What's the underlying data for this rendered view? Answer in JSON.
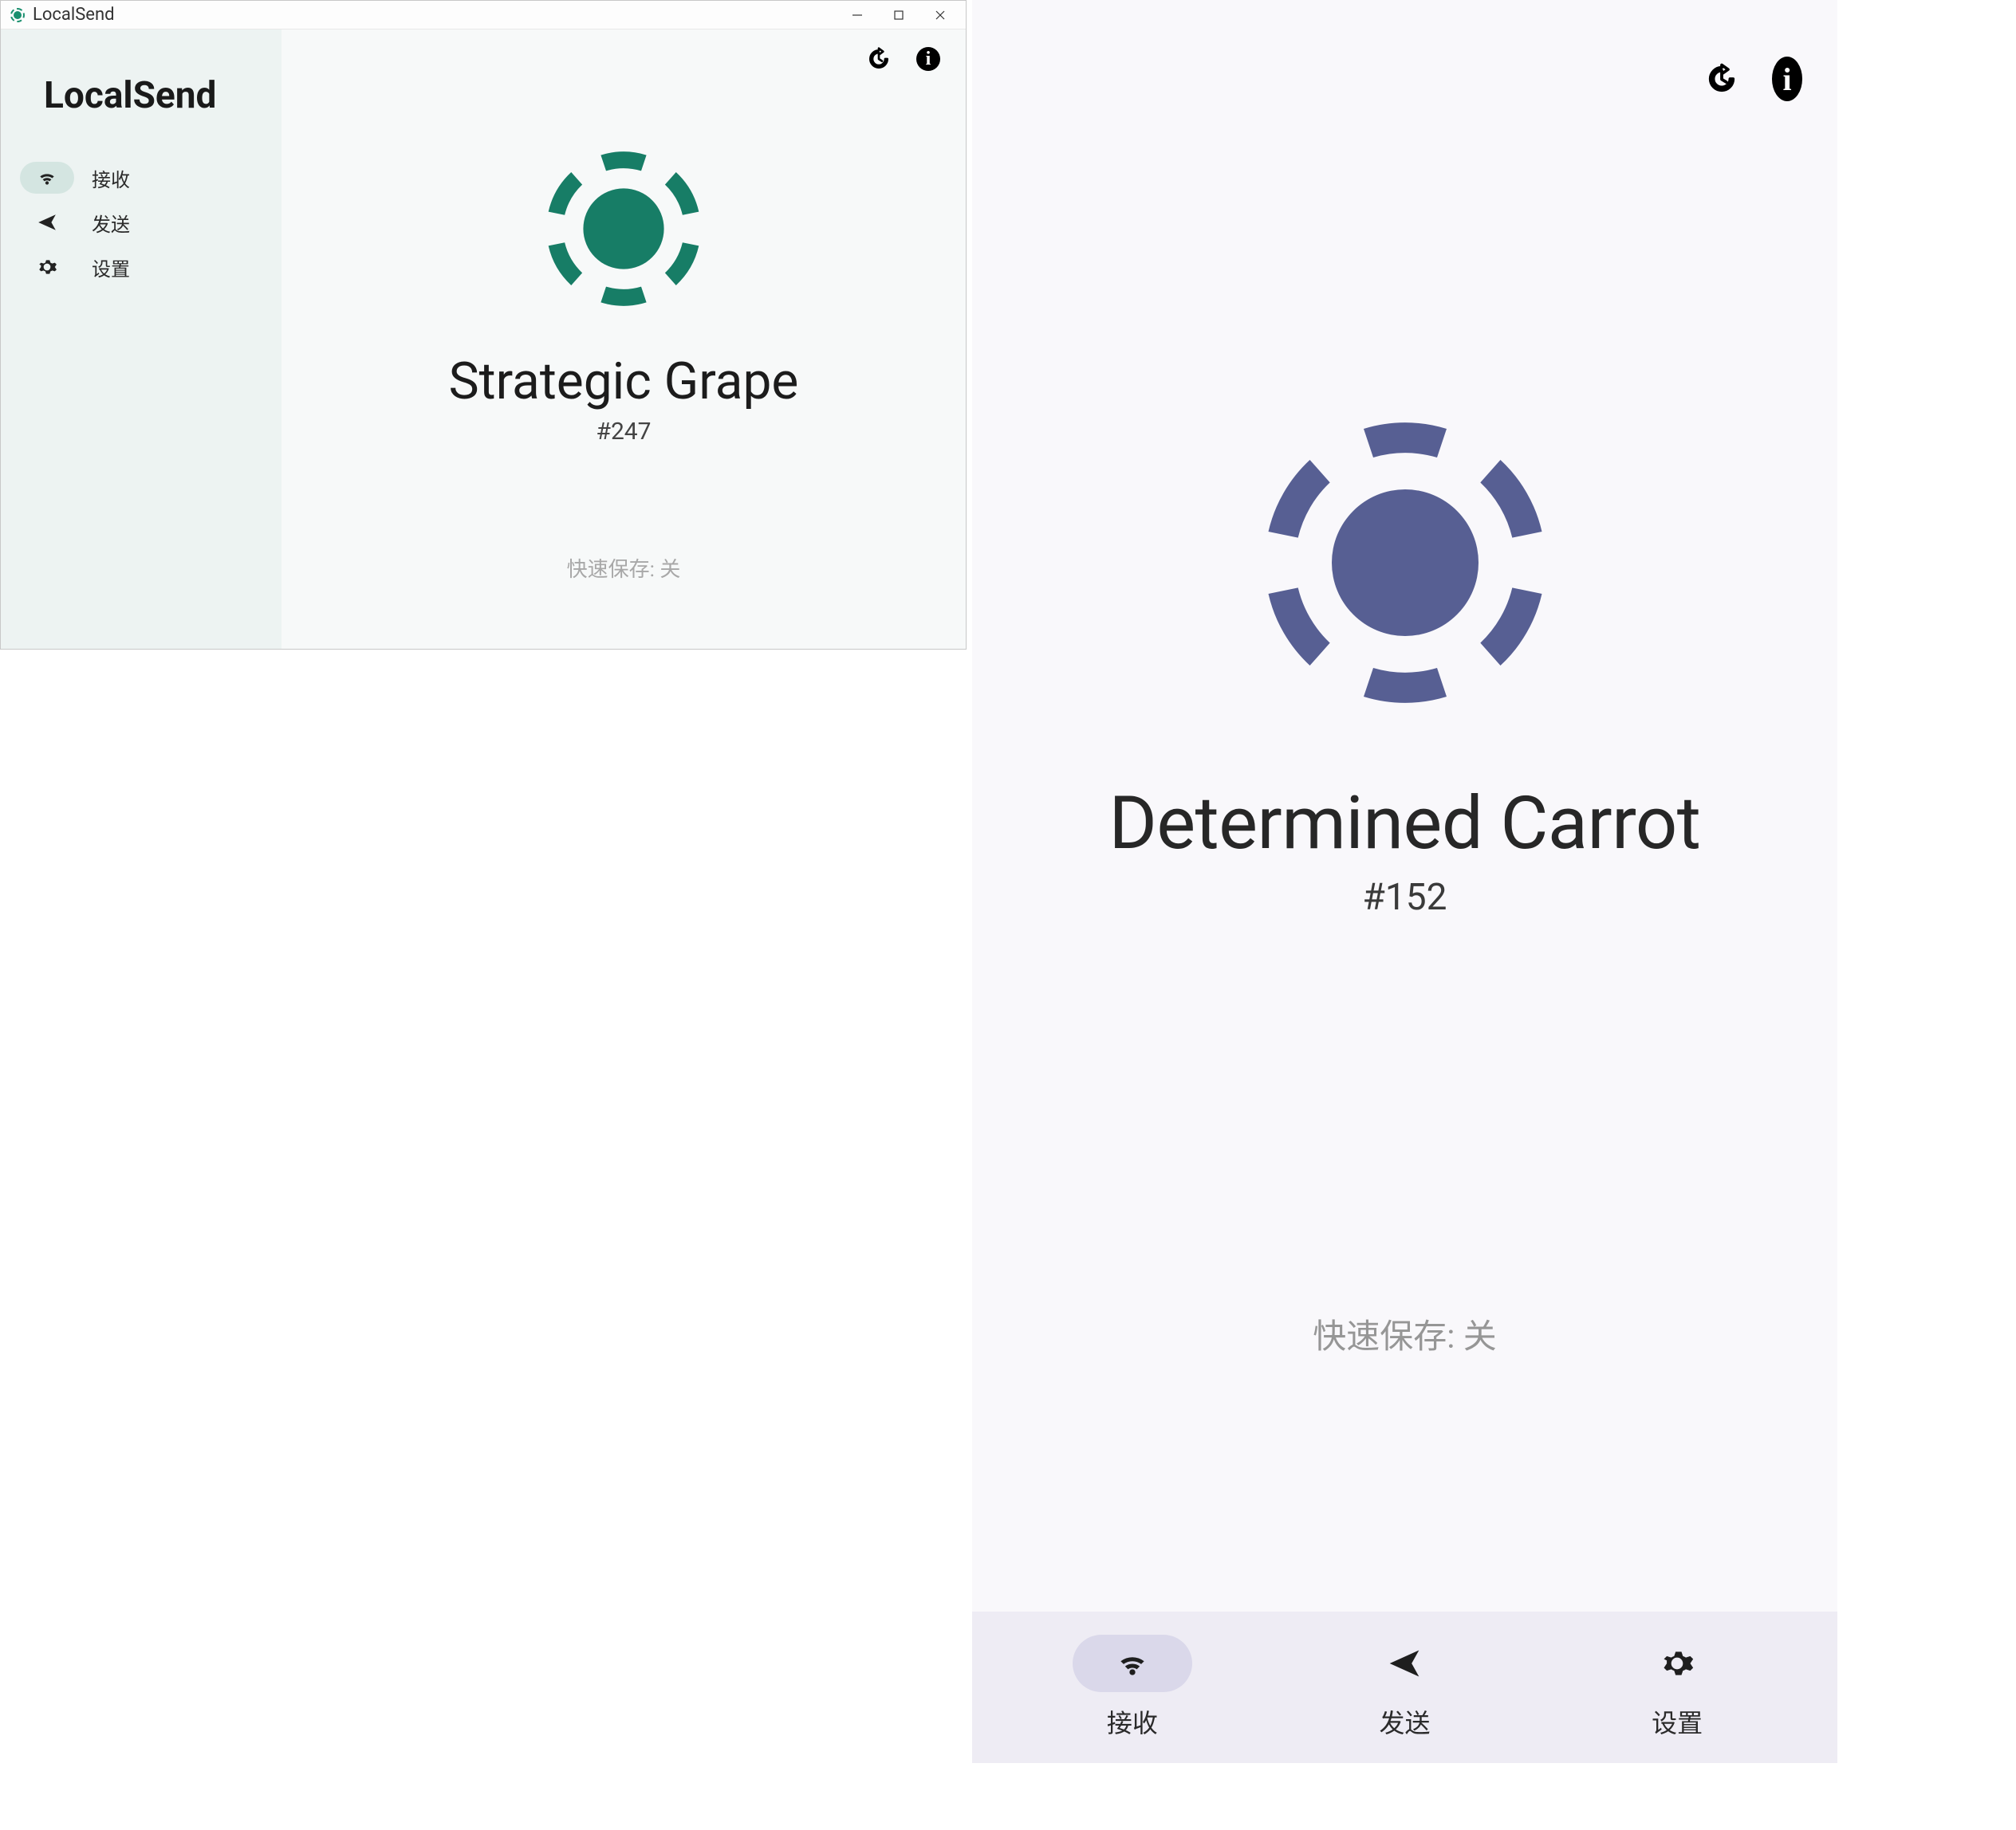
{
  "desktop": {
    "window_title": "LocalSend",
    "app_title": "LocalSend",
    "nav": [
      {
        "label": "接收",
        "icon": "wifi",
        "active": true
      },
      {
        "label": "发送",
        "icon": "send",
        "active": false
      },
      {
        "label": "设置",
        "icon": "gear",
        "active": false
      }
    ],
    "device_name": "Strategic Grape",
    "device_id": "#247",
    "quicksave_text": "快速保存: 关",
    "logo_color": "#177d66"
  },
  "mobile": {
    "device_name": "Determined Carrot",
    "device_id": "#152",
    "quicksave_text": "快速保存: 关",
    "logo_color": "#575f93",
    "nav": [
      {
        "label": "接收",
        "icon": "wifi",
        "active": true
      },
      {
        "label": "发送",
        "icon": "send",
        "active": false
      },
      {
        "label": "设置",
        "icon": "gear",
        "active": false
      }
    ]
  },
  "watermark": "                "
}
